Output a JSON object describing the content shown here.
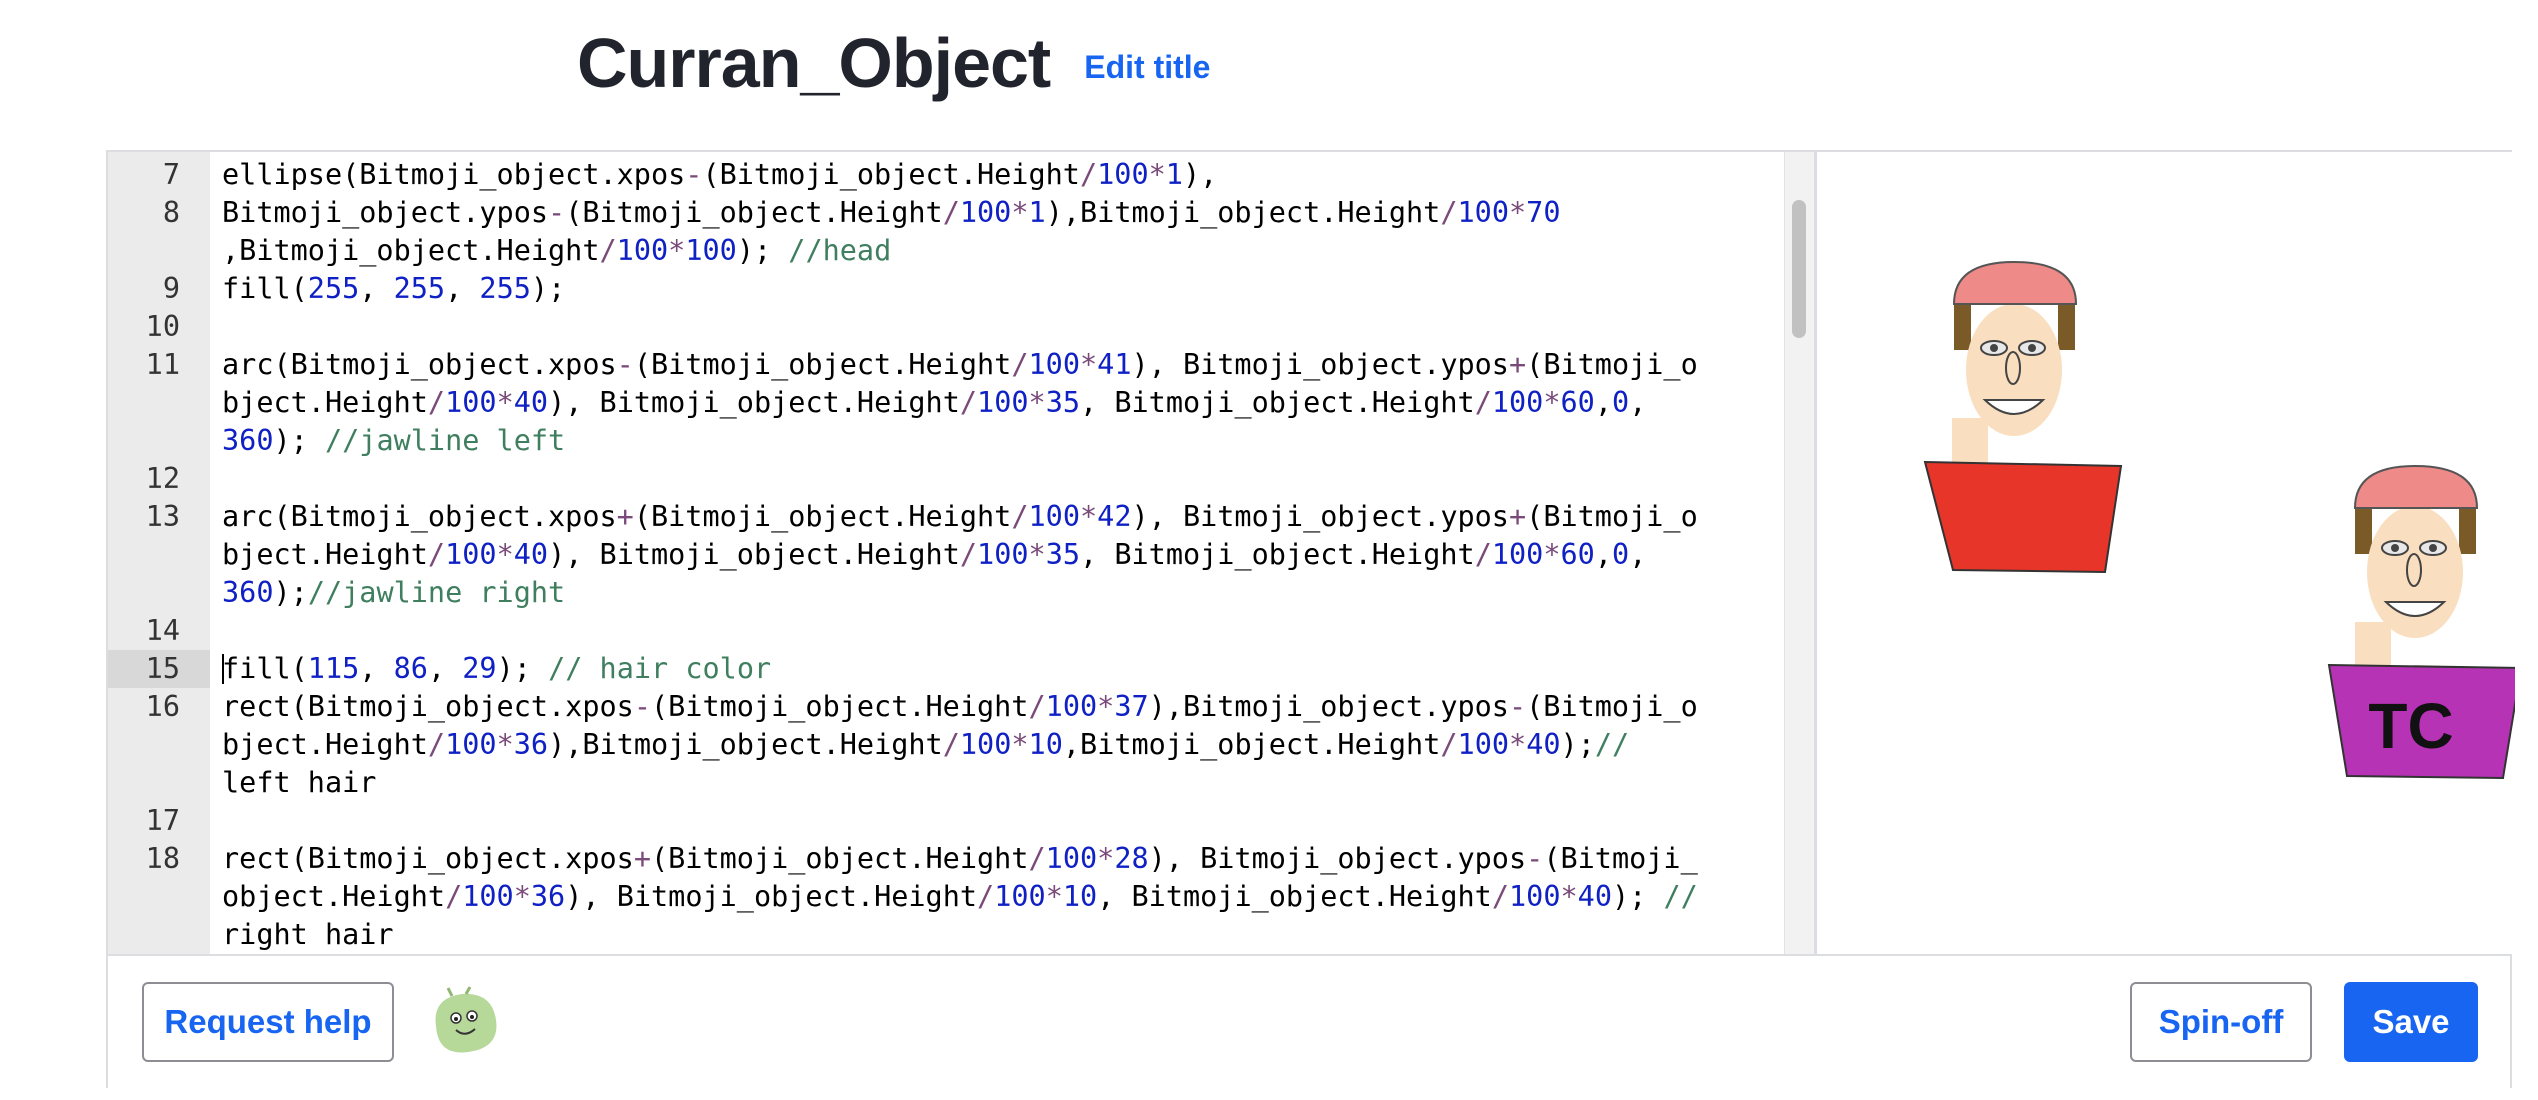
{
  "header": {
    "title": "Curran_Object",
    "edit_title_label": "Edit title"
  },
  "editor": {
    "active_line": 15,
    "lines": [
      {
        "num": "7",
        "rows": [
          "ellipse(Bitmoji_object.xpos-(Bitmoji_object.Height/100*1),"
        ]
      },
      {
        "num": "8",
        "rows": [
          "Bitmoji_object.ypos-(Bitmoji_object.Height/100*1),Bitmoji_object.Height/100*70",
          ",Bitmoji_object.Height/100*100); //head"
        ]
      },
      {
        "num": "9",
        "rows": [
          "fill(255, 255, 255);"
        ]
      },
      {
        "num": "10",
        "rows": [
          ""
        ]
      },
      {
        "num": "11",
        "rows": [
          "arc(Bitmoji_object.xpos-(Bitmoji_object.Height/100*41), Bitmoji_object.ypos+(Bitmoji_o",
          "bject.Height/100*40), Bitmoji_object.Height/100*35, Bitmoji_object.Height/100*60,0,",
          "360); //jawline left"
        ]
      },
      {
        "num": "12",
        "rows": [
          ""
        ]
      },
      {
        "num": "13",
        "rows": [
          "arc(Bitmoji_object.xpos+(Bitmoji_object.Height/100*42), Bitmoji_object.ypos+(Bitmoji_o",
          "bject.Height/100*40), Bitmoji_object.Height/100*35, Bitmoji_object.Height/100*60,0,",
          "360);//jawline right"
        ]
      },
      {
        "num": "14",
        "rows": [
          ""
        ]
      },
      {
        "num": "15",
        "rows": [
          "fill(115, 86, 29); // hair color"
        ]
      },
      {
        "num": "16",
        "rows": [
          "rect(Bitmoji_object.xpos-(Bitmoji_object.Height/100*37),Bitmoji_object.ypos-(Bitmoji_o",
          "bject.Height/100*36),Bitmoji_object.Height/100*10,Bitmoji_object.Height/100*40);//",
          "left hair"
        ]
      },
      {
        "num": "17",
        "rows": [
          ""
        ]
      },
      {
        "num": "18",
        "rows": [
          "rect(Bitmoji_object.xpos+(Bitmoji_object.Height/100*28), Bitmoji_object.ypos-(Bitmoji_",
          "object.Height/100*36), Bitmoji_object.Height/100*10, Bitmoji_object.Height/100*40); //",
          "right hair"
        ]
      }
    ]
  },
  "canvas": {
    "figure2_shirt_text": "TC",
    "colors": {
      "skin": "#f9dec0",
      "hair": "#7a5a26",
      "cap": "#ee8a87",
      "shirt1": "#e8352a",
      "shirt2": "#b733b6"
    }
  },
  "footer": {
    "request_help_label": "Request help",
    "avatar_icon": "green-blob-avatar",
    "spinoff_label": "Spin-off",
    "save_label": "Save"
  }
}
